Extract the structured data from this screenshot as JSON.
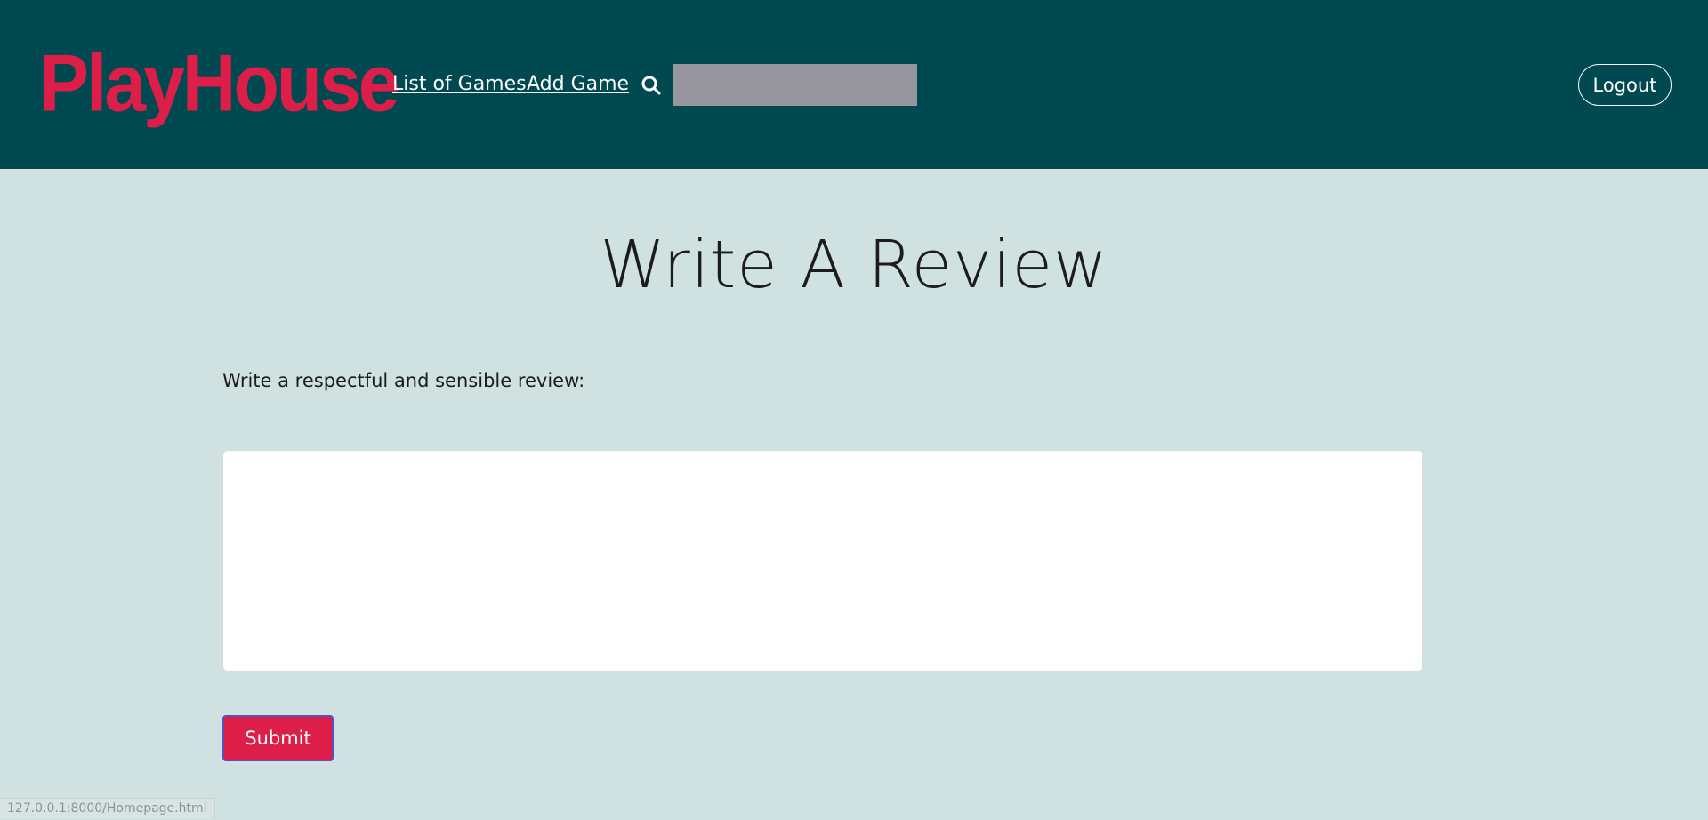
{
  "header": {
    "logo_text": "PlayHouse",
    "nav": {
      "list_of_games": "List of Games",
      "add_game": "Add Game"
    },
    "search": {
      "icon": "search-icon",
      "value": "",
      "placeholder": ""
    },
    "logout_label": "Logout"
  },
  "main": {
    "title": "Write A Review",
    "instruction": "Write a respectful and sensible review:",
    "review_value": "",
    "submit_label": "Submit"
  },
  "status_bar": {
    "url": "127.0.0.1:8000/Homepage.html"
  },
  "colors": {
    "header_background": "#004950",
    "page_background": "#cfe1e0",
    "brand_accent": "#dc1e48",
    "search_background": "#97969f"
  }
}
